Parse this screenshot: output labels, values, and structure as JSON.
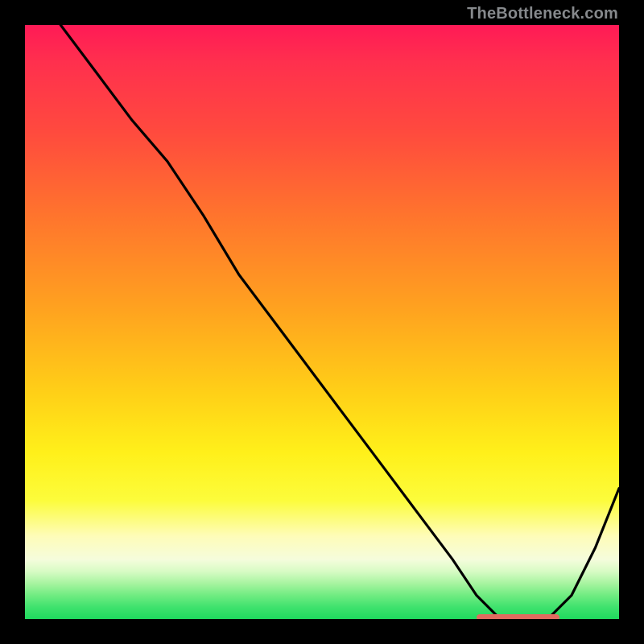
{
  "watermark": "TheBottleneck.com",
  "colors": {
    "frame": "#000000",
    "curve": "#000000",
    "marker": "#e06b5f"
  },
  "chart_data": {
    "type": "line",
    "title": "",
    "xlabel": "",
    "ylabel": "",
    "xlim": [
      0,
      100
    ],
    "ylim": [
      0,
      100
    ],
    "grid": false,
    "legend": false,
    "background": "red-to-green vertical gradient (high=red, low=green)",
    "series": [
      {
        "name": "bottleneck-curve",
        "x": [
          0,
          6,
          12,
          18,
          24,
          30,
          36,
          42,
          48,
          54,
          60,
          66,
          72,
          76,
          80,
          84,
          88,
          92,
          96,
          100
        ],
        "y": [
          110,
          100,
          92,
          84,
          77,
          68,
          58,
          50,
          42,
          34,
          26,
          18,
          10,
          4,
          0,
          0,
          0,
          4,
          12,
          22
        ]
      }
    ],
    "flat_region": {
      "x_start": 76,
      "x_end": 90,
      "y": 0
    }
  }
}
